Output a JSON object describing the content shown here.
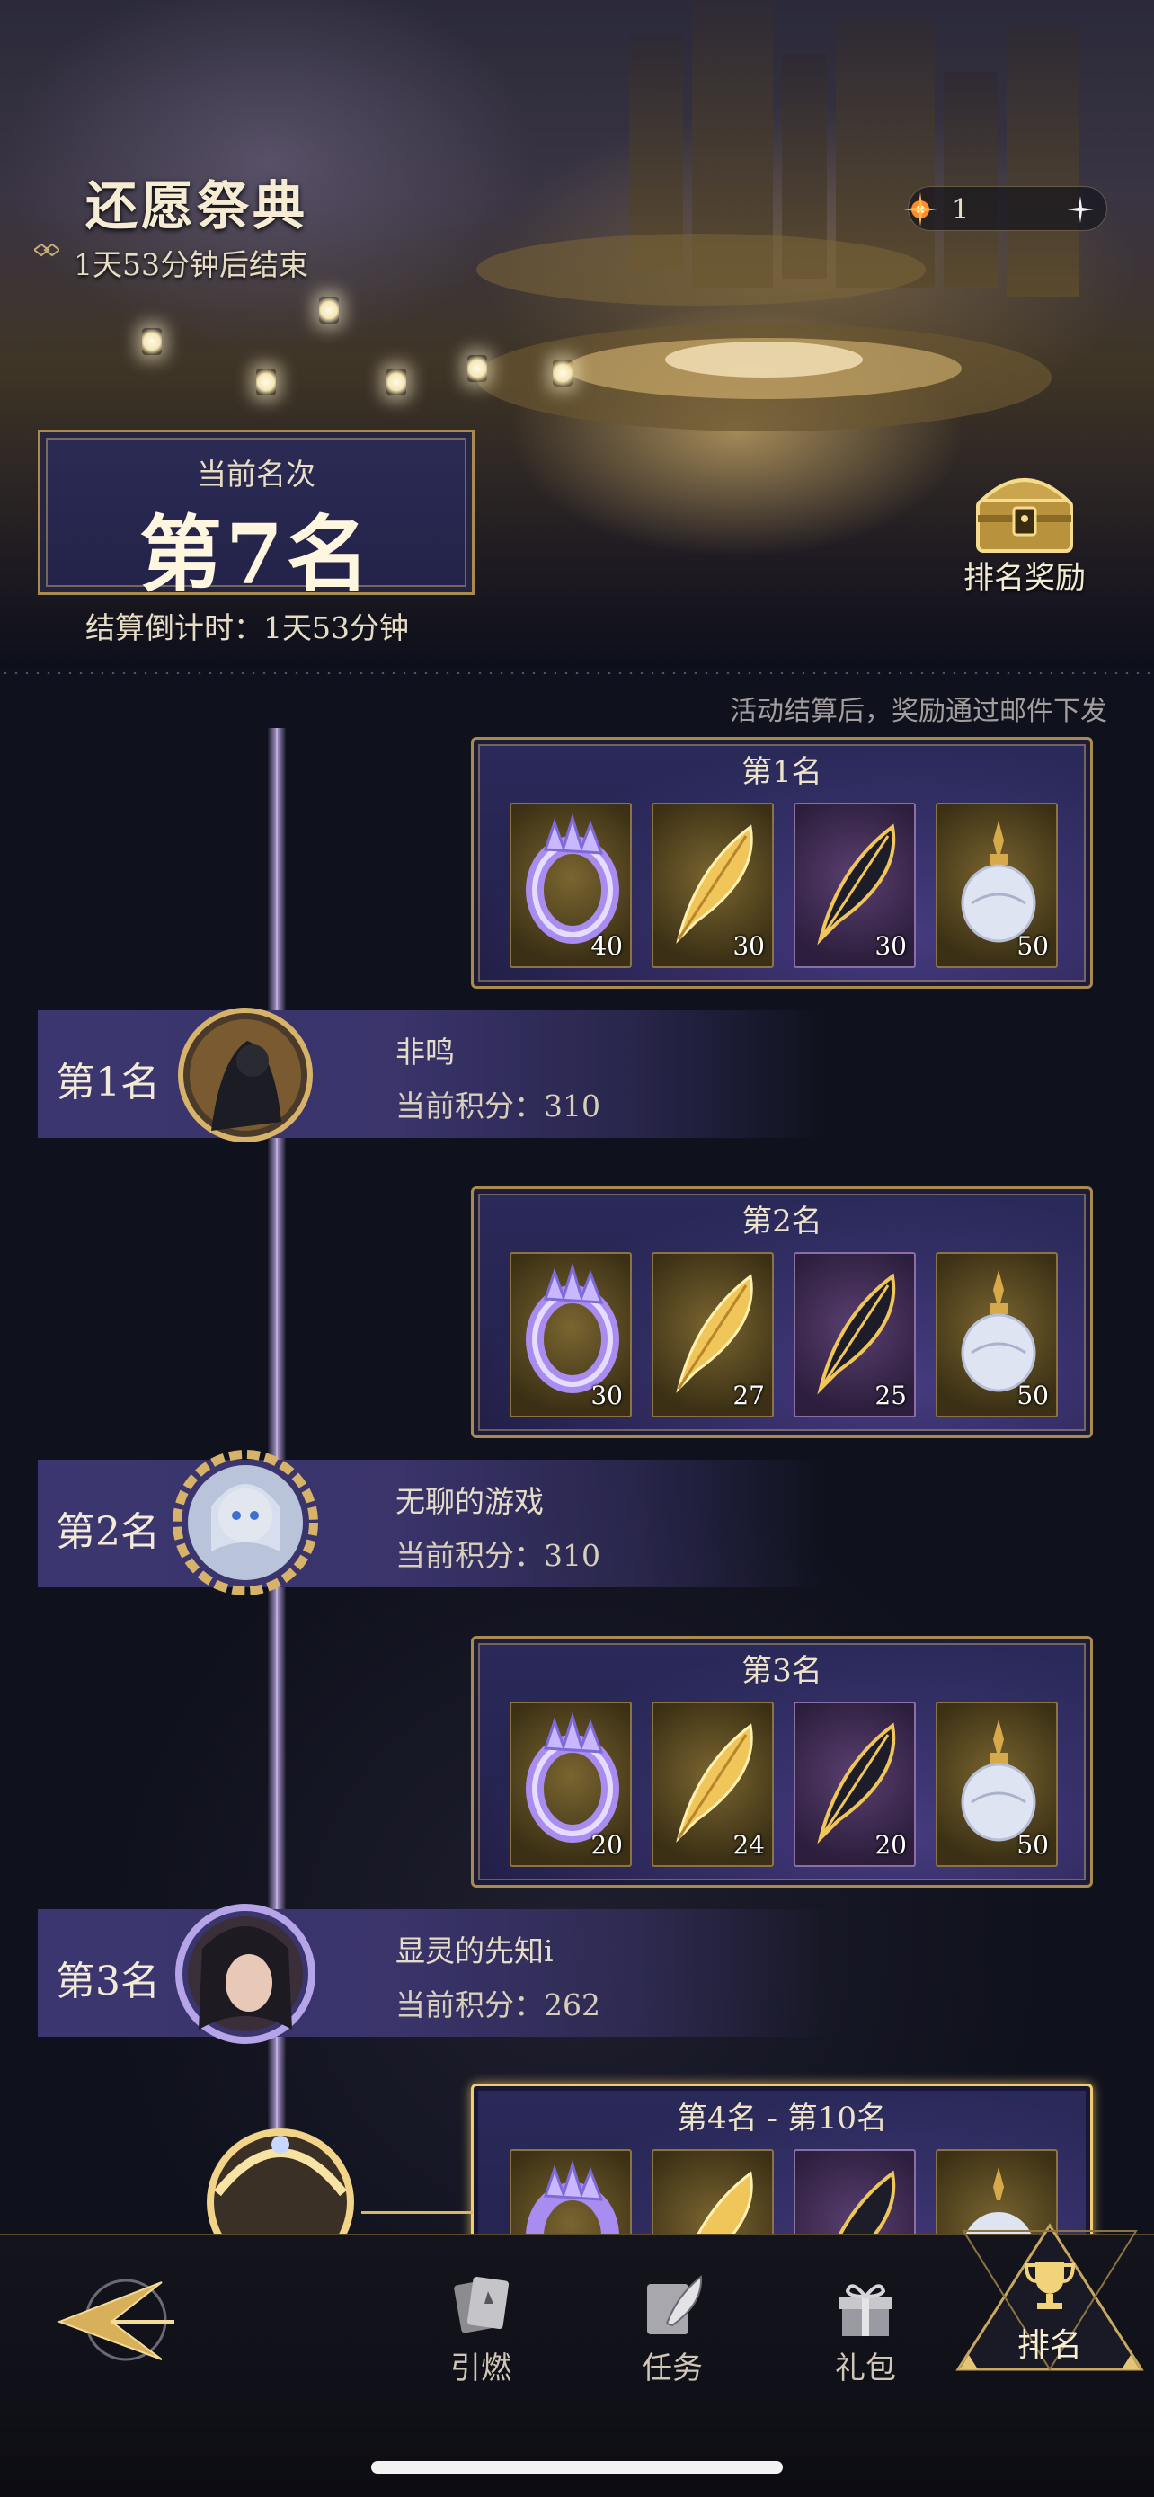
{
  "event": {
    "title": "还愿祭典",
    "subtitle": "1天53分钟后结束",
    "currency_amount": "1"
  },
  "current_rank": {
    "label": "当前名次",
    "value": "第7名",
    "countdown": "结算倒计时：1天53分钟"
  },
  "reward_button": {
    "label": "排名奖励"
  },
  "mail_note": "活动结算后，奖励通过邮件下发",
  "reward_tiers": [
    {
      "title": "第1名",
      "quantities": [
        "40",
        "30",
        "30",
        "50"
      ]
    },
    {
      "title": "第2名",
      "quantities": [
        "30",
        "27",
        "25",
        "50"
      ]
    },
    {
      "title": "第3名",
      "quantities": [
        "20",
        "24",
        "20",
        "50"
      ]
    },
    {
      "title": "第4名 - 第10名"
    }
  ],
  "players": [
    {
      "rank": "第1名",
      "name": "非鸣",
      "score": "当前积分：310"
    },
    {
      "rank": "第2名",
      "name": "无聊的游戏",
      "score": "当前积分：310"
    },
    {
      "rank": "第3名",
      "name": "显灵的先知i",
      "score": "当前积分：262"
    }
  ],
  "nav": {
    "items": [
      "引燃",
      "任务",
      "礼包",
      "排名"
    ]
  },
  "colors": {
    "accent_gold": "#a98b4f",
    "panel_purple": "#2a2a5a",
    "background": "#0f111c"
  }
}
